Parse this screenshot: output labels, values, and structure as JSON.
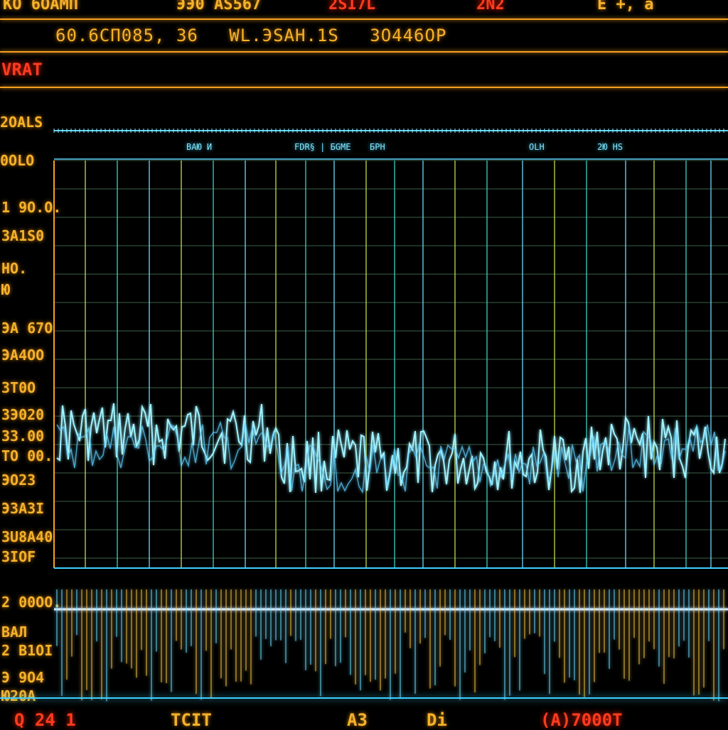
{
  "top_bar": {
    "items": [
      {
        "text": "KO  6ОАМП",
        "tone": "amber"
      },
      {
        "text": "ЭЭ0 АS567",
        "tone": "amber"
      },
      {
        "text": "2SI7L",
        "tone": "red"
      },
      {
        "text": "2N2",
        "tone": "red"
      },
      {
        "text": "E  +,  a",
        "tone": "amber"
      }
    ]
  },
  "readout": {
    "values": [
      "60.6СП085, 36",
      "WL.ЭSAH.1S",
      "3О446ОР"
    ]
  },
  "mode_label": "VRAT",
  "header_scale": "2ОАLS",
  "trace_header": {
    "scale_top": "0ОLO",
    "channel_labels": [
      "BAЮ  И",
      "FDR§ | БGME",
      "БРН",
      "OLH",
      "2Ю  НS"
    ]
  },
  "left_scale": {
    "labels": [
      "1 9О.О.",
      "ЗА1S0",
      "НО.",
      "Ю",
      "ЭА 67О",
      "ЭА4ОО",
      "ЗТ0О",
      "ЗЭ020",
      "ЗЗ.00",
      "ТО 00.",
      "ЭО23",
      "ЭЗАЗI",
      "ЗU8А40",
      "ЗIОF"
    ]
  },
  "lower_scale": {
    "labels": [
      "2 00ОО.",
      "ВАЛ",
      "2 В1ОI",
      "Э 9О4",
      "Ю20А"
    ]
  },
  "bottom_bar": {
    "items": [
      {
        "text": "Q   24   1",
        "tone": "red"
      },
      {
        "text": "ТСIТ",
        "tone": "amber"
      },
      {
        "text": "АЗ",
        "tone": "amber"
      },
      {
        "text": "Di",
        "tone": "amber"
      },
      {
        "text": "(A)7000Т",
        "tone": "red"
      }
    ]
  },
  "colors": {
    "background": "#000000",
    "amber": "#f5b12a",
    "red": "#ff3b1e",
    "trace": "#8ff0ff",
    "grid": "#3a6a5a"
  }
}
